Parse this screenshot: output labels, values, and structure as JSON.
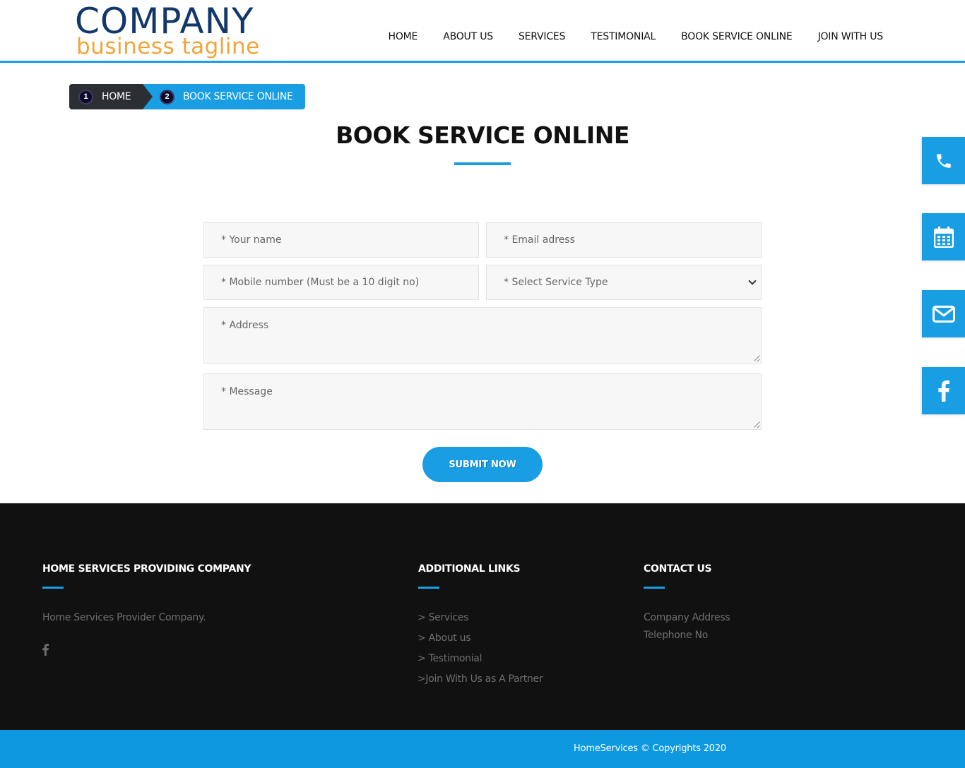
{
  "logo": {
    "company": "COMPANY",
    "tagline": "business tagline"
  },
  "nav": {
    "items": [
      "HOME",
      "ABOUT US",
      "SERVICES",
      "TESTIMONIAL",
      "BOOK SERVICE ONLINE",
      "JOIN WITH US"
    ]
  },
  "breadcrumb": {
    "home": {
      "num": "1",
      "label": "HOME"
    },
    "current": {
      "num": "2",
      "label": "BOOK SERVICE ONLINE"
    }
  },
  "page": {
    "title": "BOOK SERVICE ONLINE"
  },
  "form": {
    "name_placeholder": "* Your name",
    "email_placeholder": "* Email adress",
    "mobile_placeholder": "* Mobile number (Must be a 10 digit no)",
    "service_selected": "* Select Service Type",
    "address_placeholder": "* Address",
    "message_placeholder": "* Message",
    "submit_label": "SUBMIT NOW"
  },
  "side_buttons": [
    {
      "icon": "phone-icon"
    },
    {
      "icon": "calendar-icon"
    },
    {
      "icon": "envelope-icon"
    },
    {
      "icon": "facebook-icon"
    }
  ],
  "footer": {
    "col1": {
      "heading": "HOME SERVICES PROVIDING COMPANY",
      "text": "Home Services Provider Company.",
      "social_icon": "facebook-icon"
    },
    "col2": {
      "heading": "ADDITIONAL LINKS",
      "links": [
        "> Services",
        "> About us",
        "> Testimonial",
        ">Join With Us as A Partner"
      ]
    },
    "col3": {
      "heading": "CONTACT US",
      "address": "Company Address",
      "phone": "Telephone No"
    },
    "copyright": "HomeServices © Copyrights 2020"
  },
  "colors": {
    "accent": "#1a9ee3",
    "footer_bg": "#111111",
    "logo_blue": "#12386b",
    "logo_orange": "#f2a43a"
  }
}
